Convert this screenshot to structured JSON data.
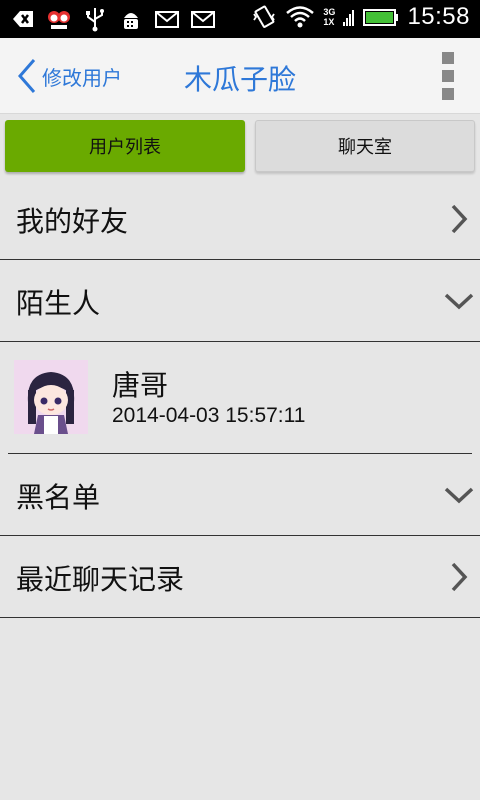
{
  "status_bar": {
    "time": "15:58",
    "network_top": "3G",
    "network_bottom": "1X",
    "icons": [
      "back-icon",
      "notification-app-icon",
      "usb-icon",
      "android-debug-icon",
      "mail-icon",
      "mail-icon",
      "vibrate-icon",
      "wifi-icon",
      "signal-icon",
      "battery-icon"
    ]
  },
  "header": {
    "back_label": "修改用户",
    "title": "木瓜子脸",
    "accent_color": "#2e78d8"
  },
  "tabs": [
    {
      "label": "用户列表",
      "active": true
    },
    {
      "label": "聊天室",
      "active": false
    }
  ],
  "list": {
    "friends_label": "我的好友",
    "strangers_label": "陌生人",
    "stranger_item": {
      "name": "唐哥",
      "time": "2014-04-03 15:57:11"
    },
    "blacklist_label": "黑名单",
    "recent_label": "最近聊天记录"
  },
  "colors": {
    "active_tab": "#6aaa00",
    "background": "#e6e6e6"
  }
}
